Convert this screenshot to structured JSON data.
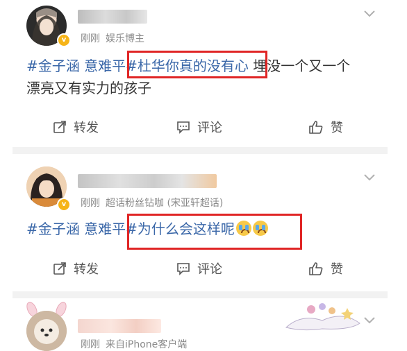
{
  "posts": [
    {
      "time": "刚刚",
      "source": "娱乐博主",
      "tags_pre": "#金子涵 意难平",
      "highlighted": "#杜华你真的没有心",
      "rest_line1": "埋没一个又一个",
      "line2": "漂亮又有实力的孩子"
    },
    {
      "time": "刚刚",
      "source": "超话粉丝钻咖 (宋亚轩超话)",
      "tags_pre": "#金子涵 意难平",
      "highlighted": "#为什么会这样呢"
    },
    {
      "time": "刚刚",
      "source": "来自iPhone客户端"
    }
  ],
  "actions": {
    "repost": "转发",
    "comment": "评论",
    "like": "赞"
  },
  "colors": {
    "hashtag": "#3a67a8",
    "highlight_box": "#e02525",
    "verified_badge": "#f6b418"
  }
}
